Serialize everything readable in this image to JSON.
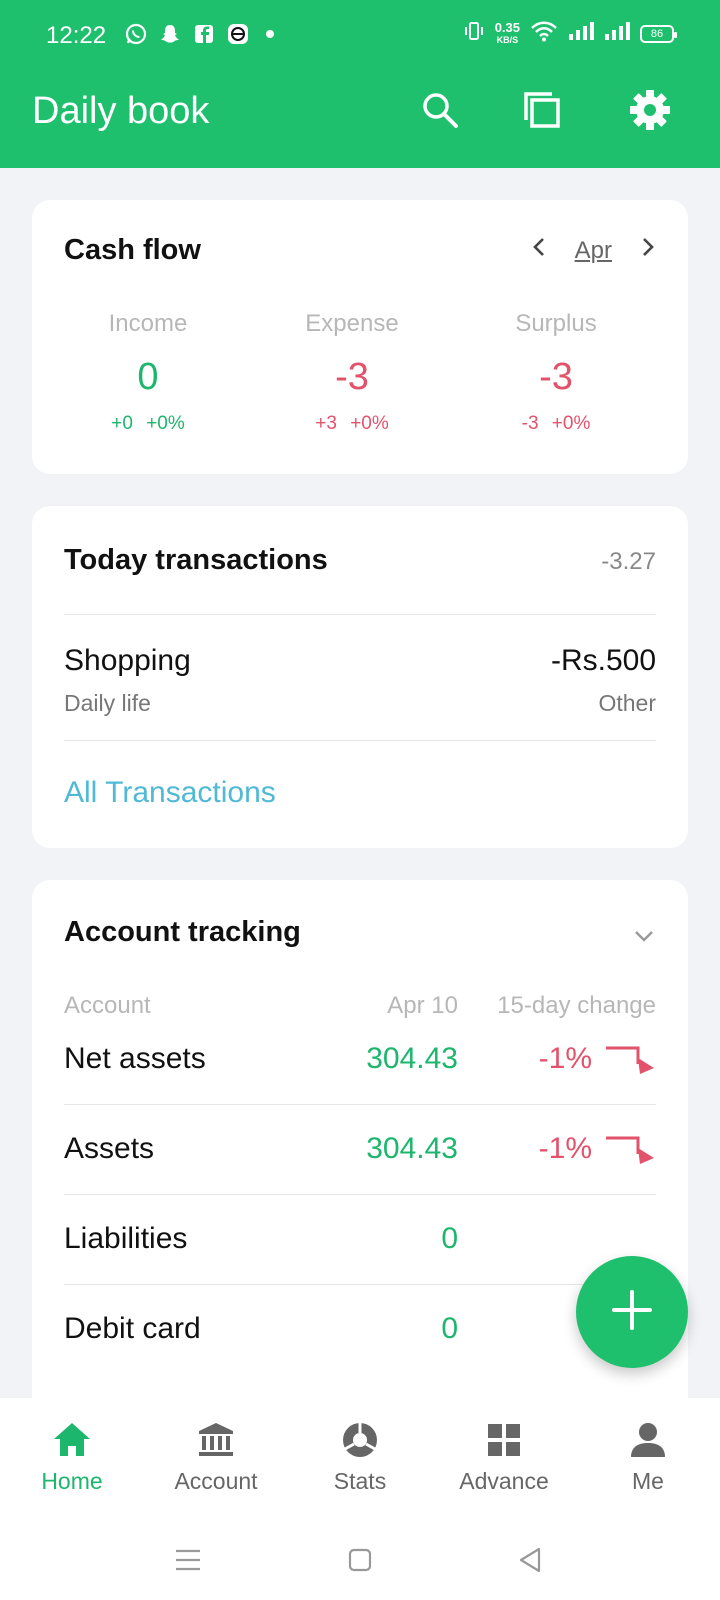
{
  "status_bar": {
    "time": "12:22",
    "net_speed_value": "0.35",
    "net_speed_unit": "KB/S",
    "battery": "86",
    "app_icons": [
      "whatsapp-icon",
      "snapchat-icon",
      "facebook-icon",
      "messenger-icon"
    ]
  },
  "header": {
    "title": "Daily book",
    "actions": [
      "search-icon",
      "copy-icon",
      "settings-gear-icon"
    ]
  },
  "cash_flow": {
    "title": "Cash flow",
    "month": "Apr",
    "columns": [
      {
        "label": "Income",
        "value": "0",
        "change": "+0 +0%",
        "color": "#1db66d"
      },
      {
        "label": "Expense",
        "value": "-3",
        "change": "+3 +0%",
        "color": "#e3526b"
      },
      {
        "label": "Surplus",
        "value": "-3",
        "change": "-3 +0%",
        "color": "#e3526b"
      }
    ]
  },
  "today_transactions": {
    "title": "Today transactions",
    "total": "-3.27",
    "items": [
      {
        "name": "Shopping",
        "category": "Daily life",
        "amount": "-Rs.500",
        "account": "Other"
      }
    ],
    "all_link": "All Transactions"
  },
  "account_tracking": {
    "title": "Account tracking",
    "headers": {
      "account": "Account",
      "date": "Apr 10",
      "change": "15-day change"
    },
    "rows": [
      {
        "name": "Net assets",
        "value": "304.43",
        "change": "-1%"
      },
      {
        "name": "Assets",
        "value": "304.43",
        "change": "-1%"
      },
      {
        "name": "Liabilities",
        "value": "0",
        "change": ""
      },
      {
        "name": "Debit card",
        "value": "0",
        "change": ""
      }
    ]
  },
  "bottom_nav": {
    "items": [
      {
        "label": "Home",
        "icon": "home-icon",
        "active": true
      },
      {
        "label": "Account",
        "icon": "bank-icon",
        "active": false
      },
      {
        "label": "Stats",
        "icon": "pie-chart-icon",
        "active": false
      },
      {
        "label": "Advance",
        "icon": "grid-icon",
        "active": false
      },
      {
        "label": "Me",
        "icon": "person-icon",
        "active": false
      }
    ]
  },
  "colors": {
    "brand": "#1ec06d",
    "positive": "#1db66d",
    "negative": "#e3526b",
    "link": "#4fb9d6"
  }
}
